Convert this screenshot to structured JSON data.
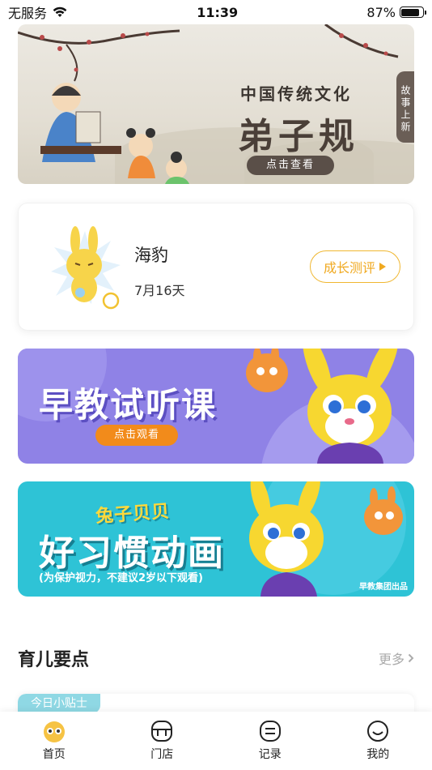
{
  "status_bar": {
    "carrier": "无服务",
    "time": "11:39",
    "battery": "87%",
    "battery_level": 0.87
  },
  "banner": {
    "title_top": "中国传统文化",
    "title_main": "弟子规",
    "button": "点击查看",
    "side_tag": "故事上新",
    "dots_count": 8,
    "active_dot": 1
  },
  "profile": {
    "name": "海豹",
    "age": "7月16天",
    "growth_button": "成长测评"
  },
  "promos": {
    "trial": {
      "title": "早教试听课",
      "button": "点击观看",
      "bg_color": "#8f82e6"
    },
    "habit": {
      "subtitle": "兔子贝贝",
      "title": "好习惯动画",
      "note": "(为保护视力，不建议2岁以下观看)",
      "credit": "早教集团出品",
      "bg_color": "#2ec3d6"
    }
  },
  "section": {
    "title": "育儿要点",
    "more": "更多",
    "tip_badge": "今日小贴士"
  },
  "tabs": [
    {
      "label": "首页",
      "icon": "home-face-icon",
      "active": true
    },
    {
      "label": "门店",
      "icon": "store-icon",
      "active": false
    },
    {
      "label": "记录",
      "icon": "record-icon",
      "active": false
    },
    {
      "label": "我的",
      "icon": "smile-profile-icon",
      "active": false
    }
  ],
  "colors": {
    "accent": "#f0b12c",
    "growth_button": "#f0a920"
  }
}
